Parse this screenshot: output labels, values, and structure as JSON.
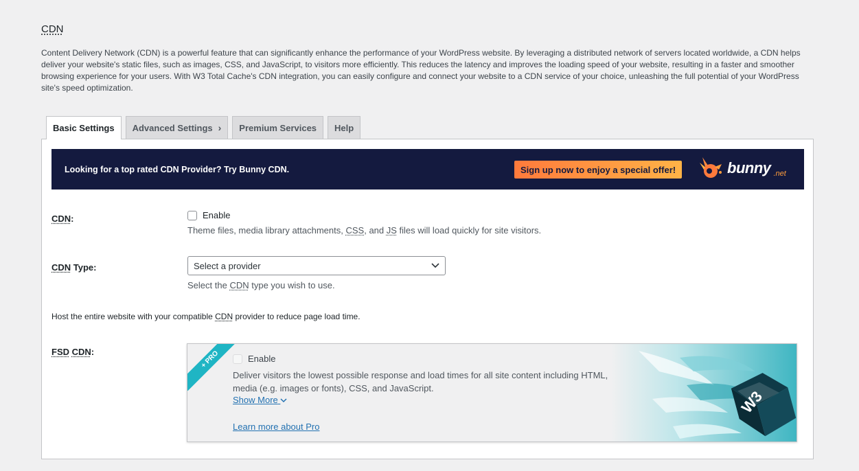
{
  "page": {
    "title": "CDN",
    "intro": "Content Delivery Network (CDN) is a powerful feature that can significantly enhance the performance of your WordPress website. By leveraging a distributed network of servers located worldwide, a CDN helps deliver your website's static files, such as images, CSS, and JavaScript, to visitors more efficiently. This reduces the latency and improves the loading speed of your website, resulting in a faster and smoother browsing experience for your users. With W3 Total Cache's CDN integration, you can easily configure and connect your website to a CDN service of your choice, unleashing the full potential of your WordPress site's speed optimization."
  },
  "tabs": [
    {
      "label": "Basic Settings",
      "active": true
    },
    {
      "label": "Advanced Settings",
      "chevron": "›"
    },
    {
      "label": "Premium Services"
    },
    {
      "label": "Help"
    }
  ],
  "banner": {
    "text": "Looking for a top rated CDN Provider? Try Bunny CDN.",
    "button": "Sign up now to enjoy a special offer!",
    "logo_word": "bunny",
    "logo_suffix": ".net"
  },
  "cdn_row": {
    "label": "CDN",
    "checkbox_label": "Enable",
    "desc_pre": "Theme files, media library attachments, ",
    "desc_css": "CSS",
    "desc_and": ", and ",
    "desc_js": "JS",
    "desc_post": " files will load quickly for site visitors."
  },
  "cdn_type_row": {
    "label_abbr": "CDN",
    "label_rest": " Type:",
    "select_value": "Select a provider",
    "desc_pre": "Select the ",
    "desc_abbr": "CDN",
    "desc_post": " type you wish to use."
  },
  "host_text": {
    "pre": "Host the entire website with your compatible ",
    "abbr": "CDN",
    "post": " provider to reduce page load time."
  },
  "fsd_row": {
    "label_a": "FSD",
    "label_b": "CDN",
    "ribbon": "+ PRO",
    "checkbox_label": "Enable",
    "desc": "Deliver visitors the lowest possible response and load times for all site content including HTML, media (e.g. images or fonts), CSS, and JavaScript.",
    "show_more": "Show More",
    "learn_more": "Learn more about Pro",
    "badge_text": "W3"
  },
  "colors": {
    "banner_bg": "#141a3f",
    "accent_orange": "#ff8a3d",
    "link": "#2271b1",
    "pro_teal": "#1fb5c4"
  }
}
